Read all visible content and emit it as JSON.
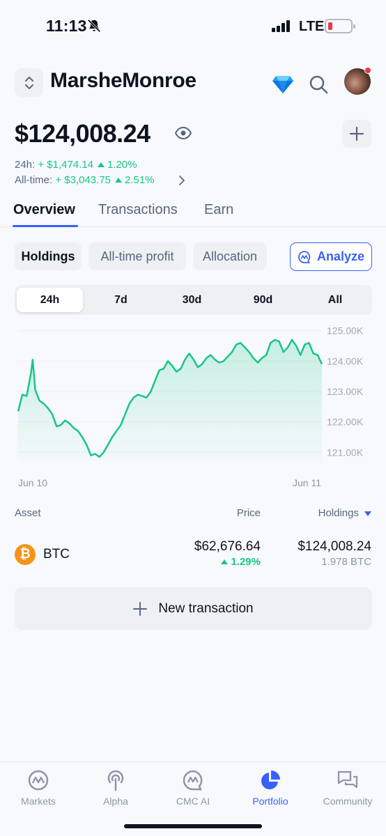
{
  "status_bar": {
    "time": "11:13",
    "network": "LTE"
  },
  "header": {
    "portfolio_name": "MarsheMonroe"
  },
  "balance": {
    "total": "$124,008.24",
    "change_24h_label": "24h:",
    "change_24h_value": "+ $1,474.14",
    "change_24h_pct": "1.20%",
    "alltime_label": "All-time:",
    "alltime_value": "+ $3,043.75",
    "alltime_pct": "2.51%"
  },
  "tabs": [
    "Overview",
    "Transactions",
    "Earn"
  ],
  "chips": {
    "holdings": "Holdings",
    "profit": "All-time profit",
    "allocation": "Allocation",
    "analyze": "Analyze"
  },
  "timeframes": [
    "24h",
    "7d",
    "30d",
    "90d",
    "All"
  ],
  "chart_data": {
    "type": "area",
    "x_start_label": "Jun 10",
    "x_end_label": "Jun 11",
    "y_ticks": [
      "125.00K",
      "124.00K",
      "123.00K",
      "122.00K",
      "121.00K"
    ],
    "ylim": [
      120800,
      125200
    ],
    "color": "#16c784",
    "values": [
      122350,
      122900,
      122850,
      123600,
      123050,
      122700,
      122600,
      122450,
      122250,
      121850,
      121900,
      122050,
      121950,
      121800,
      121700,
      121500,
      121250,
      120900,
      120950,
      120850,
      121000,
      121250,
      121500,
      121700,
      121900,
      122250,
      122600,
      122800,
      122900,
      122850,
      122800,
      123000,
      123350,
      123700,
      123750,
      124000,
      123850,
      123650,
      123750,
      124050,
      124250,
      124050,
      123800,
      123900,
      124100,
      124200,
      124050,
      123950,
      124000,
      124150,
      124300,
      124550,
      124600,
      124450,
      124300,
      124100,
      123950,
      124100,
      124200,
      124600,
      124700,
      124650,
      124300,
      124450,
      124700,
      124500,
      124200,
      124550,
      124600,
      124250,
      124200,
      123900
    ],
    "spikes": [
      {
        "index": 3,
        "value": 124050
      }
    ]
  },
  "table": {
    "col_asset": "Asset",
    "col_price": "Price",
    "col_holdings": "Holdings",
    "rows": [
      {
        "symbol": "BTC",
        "price": "$62,676.64",
        "change": "1.29%",
        "holdings_value": "$124,008.24",
        "holdings_amount": "1.978 BTC"
      }
    ]
  },
  "new_transaction": "New transaction",
  "bottom_nav": [
    "Markets",
    "Alpha",
    "CMC AI",
    "Portfolio",
    "Community"
  ],
  "colors": {
    "accent": "#3861fb",
    "positive": "#16c784",
    "btc": "#f7931a"
  }
}
